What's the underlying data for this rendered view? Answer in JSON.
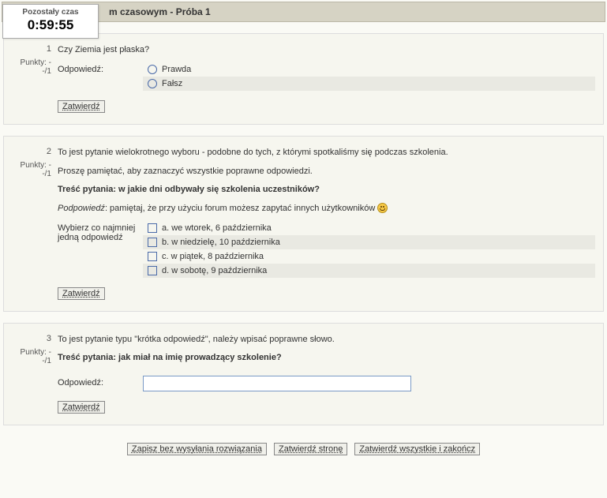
{
  "timer": {
    "label": "Pozostały czas",
    "value": "0:59:55"
  },
  "header": {
    "title": "m czasowym - Próba 1"
  },
  "questions": [
    {
      "number": "1",
      "points": "Punkty: --/1",
      "text": "Czy Ziemia jest płaska?",
      "answer_label": "Odpowiedź:",
      "type": "radio",
      "options": [
        "Prawda",
        "Fałsz"
      ],
      "submit": "Zatwierdź"
    },
    {
      "number": "2",
      "points": "Punkty: --/1",
      "intro1": "To jest pytanie wielokrotnego wyboru - podobne do tych, z którymi spotkaliśmy się podczas szkolenia.",
      "intro2": "Proszę pamiętać, aby zaznaczyć wszystkie poprawne odpowiedzi.",
      "bold": "Treść pytania: w jakie dni odbywały się szkolenia uczestników?",
      "hint_label": "Podpowiedź",
      "hint_text": ": pamiętaj, że przy użyciu forum możesz zapytać innych użytkowników ",
      "answer_label": "Wybierz co najmniej jedną odpowiedź",
      "type": "checkbox",
      "options": [
        "a. we wtorek, 6 października",
        "b. w niedzielę, 10 października",
        "c. w piątek, 8 października",
        "d. w sobotę, 9 października"
      ],
      "submit": "Zatwierdź"
    },
    {
      "number": "3",
      "points": "Punkty: --/1",
      "intro1": "To jest pytanie typu \"krótka odpowiedź\", należy wpisać poprawne słowo.",
      "bold": "Treść pytania: jak miał na imię prowadzący szkolenie?",
      "answer_label": "Odpowiedź:",
      "type": "text",
      "submit": "Zatwierdź"
    }
  ],
  "footer": {
    "save": "Zapisz bez wysyłania rozwiązania",
    "submit_page": "Zatwierdź stronę",
    "submit_all": "Zatwierdź wszystkie i zakończ"
  }
}
